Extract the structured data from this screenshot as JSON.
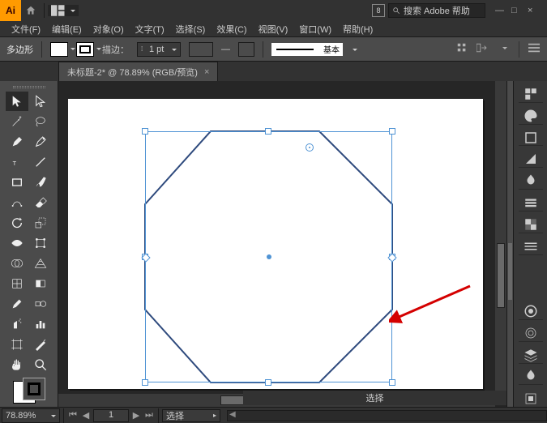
{
  "app": {
    "logo_text": "Ai",
    "search_placeholder": "搜索 Adobe 帮助",
    "doc_marker": "8"
  },
  "menubar": [
    "文件(F)",
    "编辑(E)",
    "对象(O)",
    "文字(T)",
    "选择(S)",
    "效果(C)",
    "视图(V)",
    "窗口(W)",
    "帮助(H)"
  ],
  "options": {
    "shape_name": "多边形",
    "stroke_label": "描边：",
    "stroke_weight": "1 pt",
    "style_label": "基本"
  },
  "document": {
    "tab_title": "未标题-2* @ 78.89% (RGB/预览)",
    "close": "×"
  },
  "status": {
    "zoom": "78.89%",
    "artboard": "1",
    "tool": "选择"
  },
  "window_btns": {
    "min": "—",
    "max": "□",
    "close": "×"
  }
}
